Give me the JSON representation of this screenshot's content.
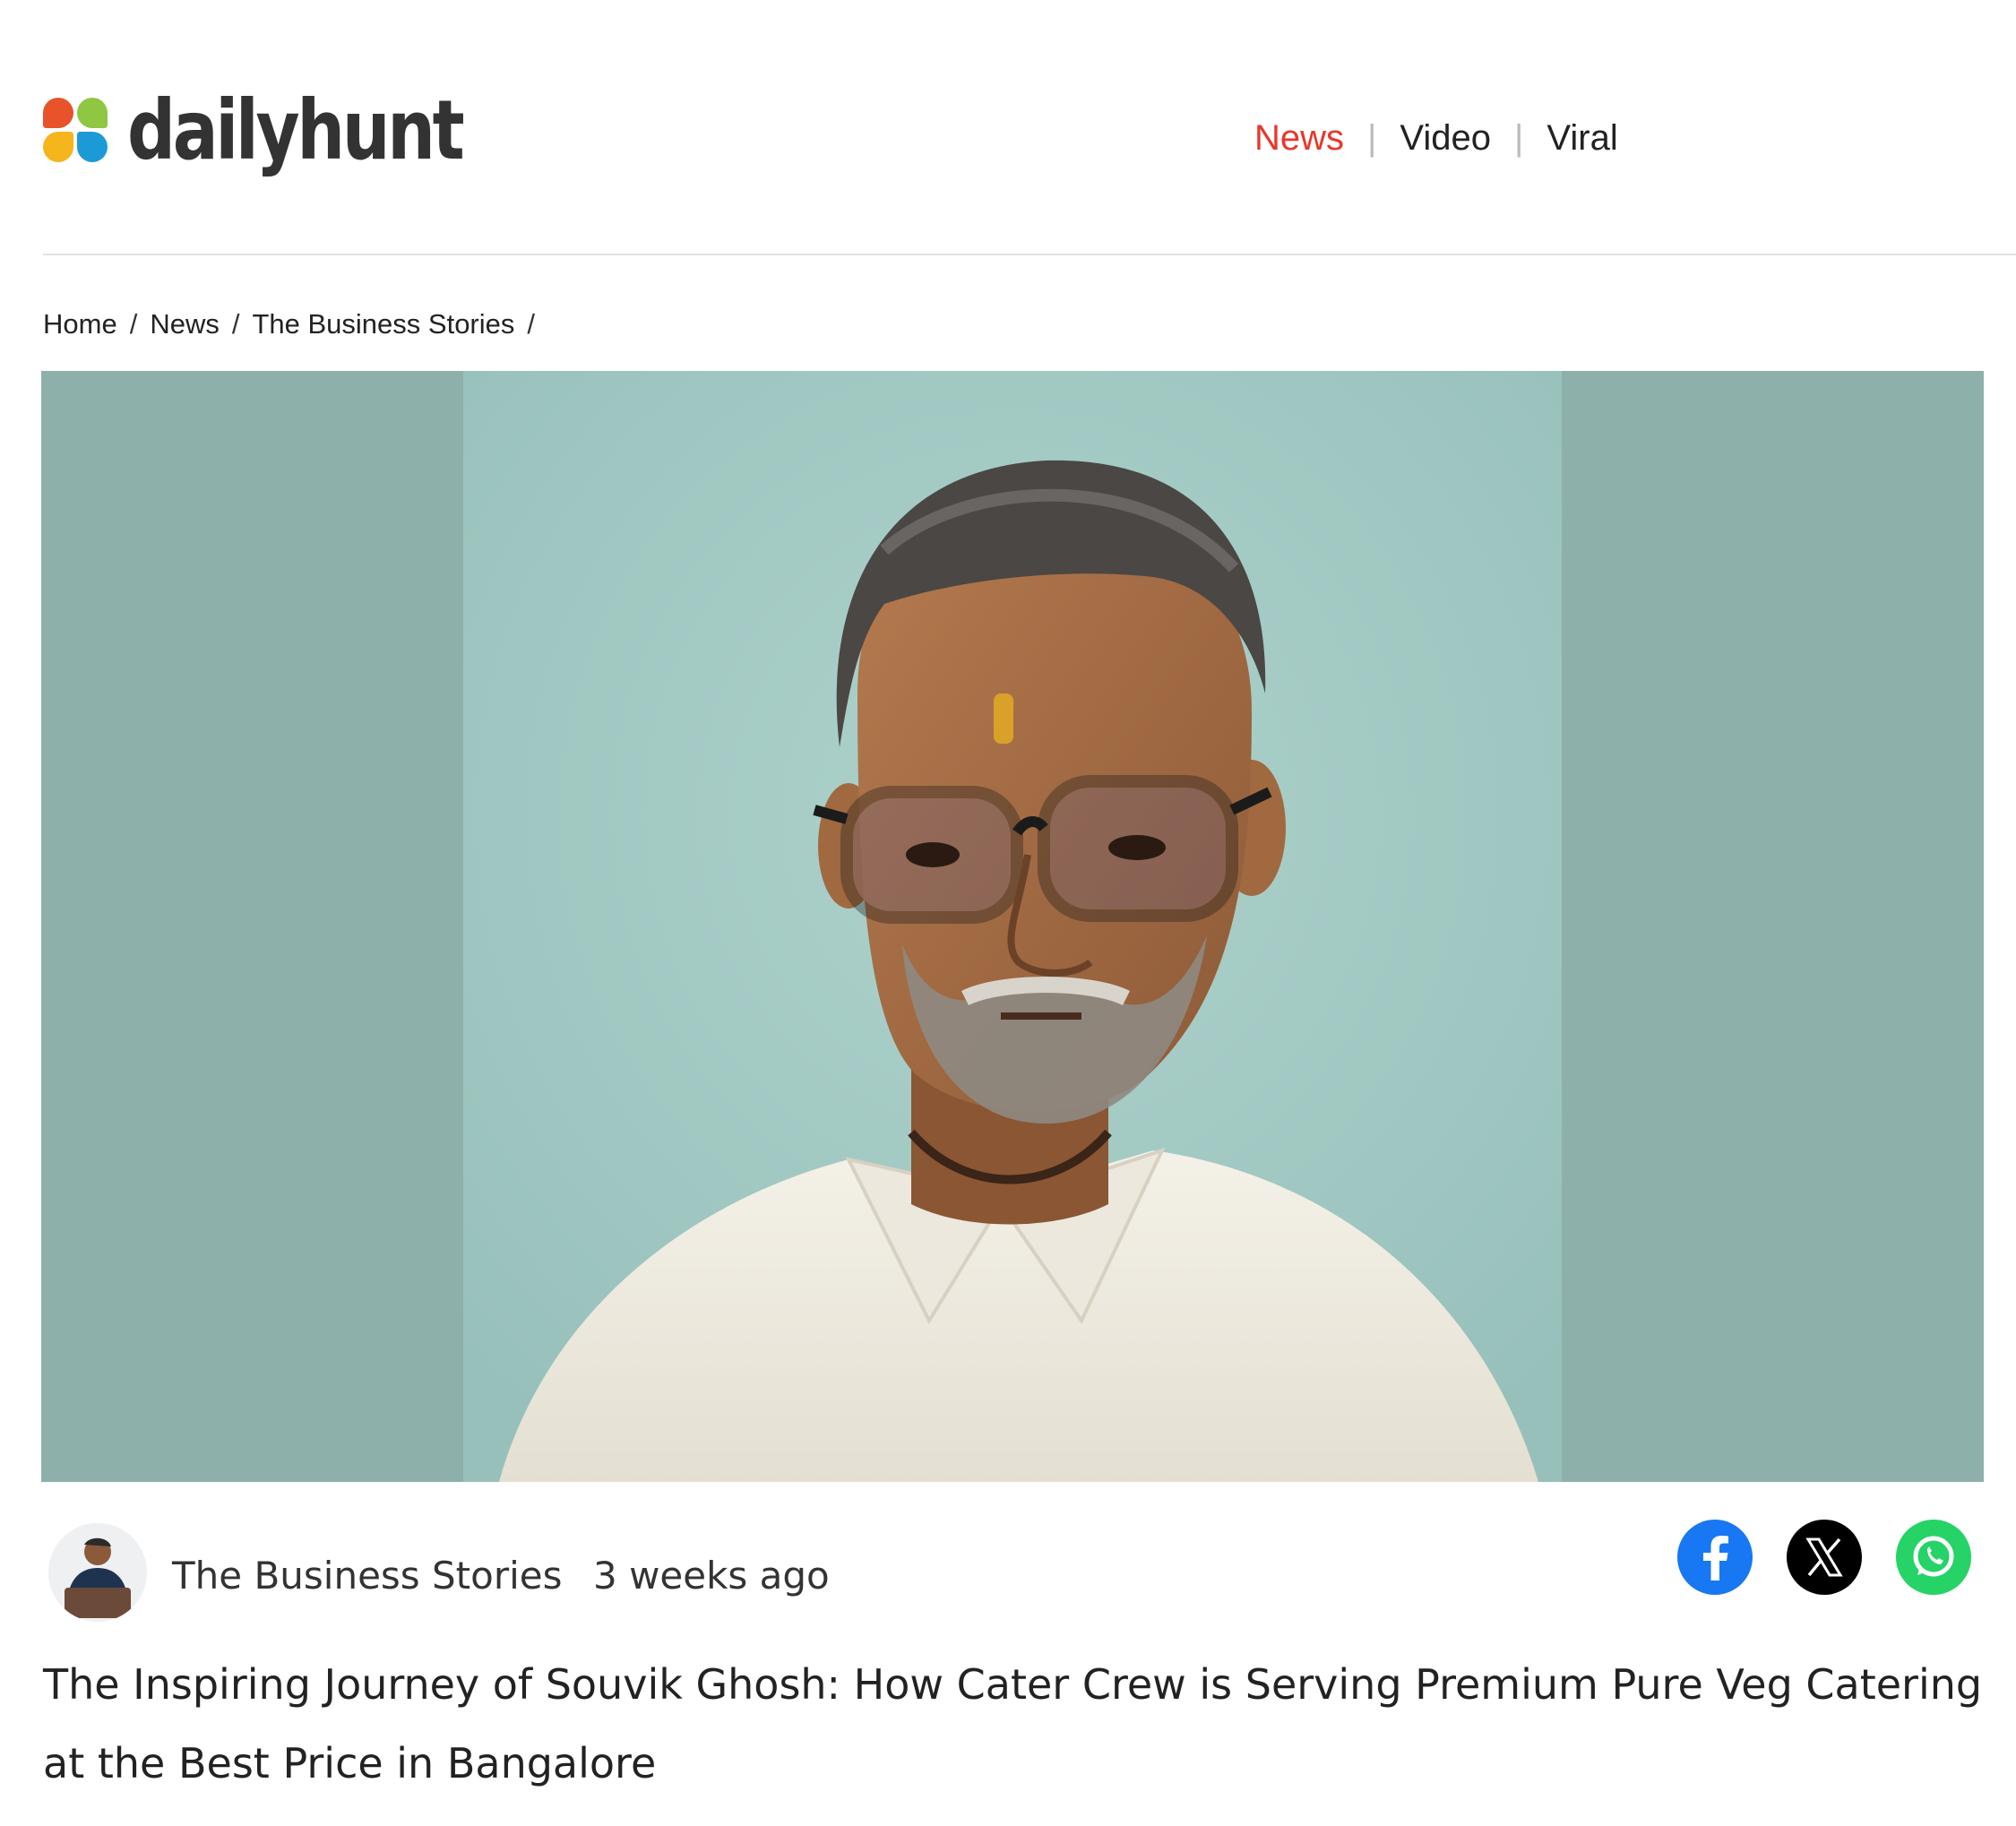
{
  "brand": {
    "name": "dailyhunt"
  },
  "nav": {
    "items": [
      "News",
      "Video",
      "Viral"
    ],
    "active": "News"
  },
  "colors": {
    "accent": "#e8372c",
    "facebook": "#1877f2",
    "x": "#000000",
    "whatsapp": "#25d366"
  },
  "breadcrumb": [
    "Home",
    "News",
    "The Business Stories"
  ],
  "article": {
    "source": "The Business Stories",
    "time": "3 weeks ago",
    "title": "The Inspiring Journey of Souvik Ghosh: How Cater Crew is Serving Premium Pure Veg Catering at the Best Price in Bangalore"
  },
  "share": {
    "icons": [
      "facebook-icon",
      "x-icon",
      "whatsapp-icon"
    ]
  }
}
